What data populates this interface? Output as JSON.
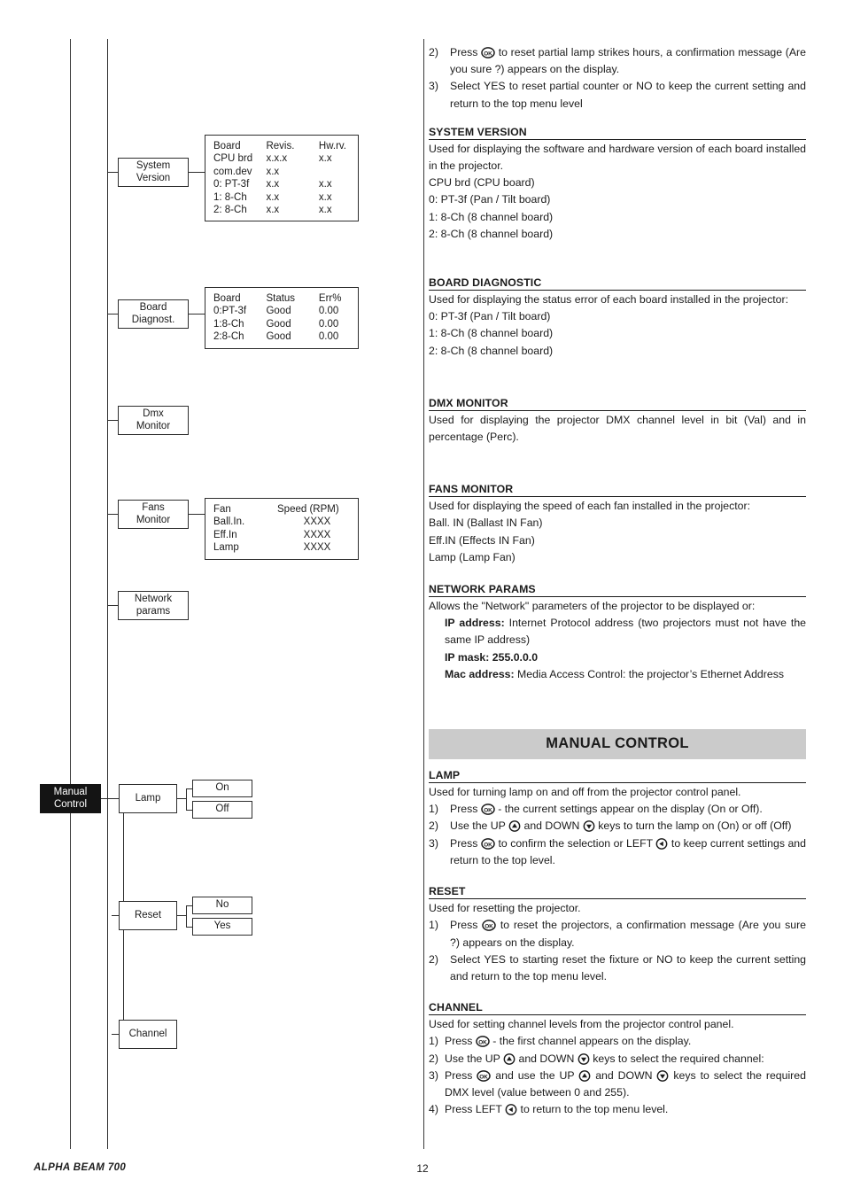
{
  "footer": {
    "model": "ALPHA BEAM 700",
    "page": "12"
  },
  "icons": {
    "ok": "OK",
    "up": "up-arrow",
    "down": "down-arrow",
    "left": "left-arrow"
  },
  "diagram": {
    "nodes": {
      "system_version": {
        "line1": "System",
        "line2": "Version"
      },
      "board_diagnost": {
        "line1": "Board",
        "line2": "Diagnost."
      },
      "dmx_monitor": {
        "line1": "Dmx",
        "line2": "Monitor"
      },
      "fans_monitor": {
        "line1": "Fans",
        "line2": "Monitor"
      },
      "network_params": {
        "line1": "Network",
        "line2": "params"
      },
      "manual_control": {
        "line1": "Manual",
        "line2": "Control"
      },
      "lamp": {
        "line1": "Lamp",
        "line2": ""
      },
      "lamp_on": {
        "line1": "On",
        "line2": ""
      },
      "lamp_off": {
        "line1": "Off",
        "line2": ""
      },
      "reset": {
        "line1": "Reset",
        "line2": ""
      },
      "reset_no": {
        "line1": "No",
        "line2": ""
      },
      "reset_yes": {
        "line1": "Yes",
        "line2": ""
      },
      "channel": {
        "line1": "Channel",
        "line2": ""
      }
    },
    "system_version_table": {
      "headers": [
        "Board",
        "Revis.",
        "Hw.rv."
      ],
      "rows": [
        [
          "CPU brd",
          "x.x.x",
          "x.x"
        ],
        [
          "com.dev",
          "x.x",
          ""
        ],
        [
          "0: PT-3f",
          "x.x",
          "x.x"
        ],
        [
          "1: 8-Ch",
          "x.x",
          "x.x"
        ],
        [
          "2: 8-Ch",
          "x.x",
          "x.x"
        ]
      ]
    },
    "board_diagnostic_table": {
      "headers": [
        "Board",
        "Status",
        "Err%"
      ],
      "rows": [
        [
          "0:PT-3f",
          "Good",
          "0.00"
        ],
        [
          "1:8-Ch",
          "Good",
          "0.00"
        ],
        [
          "2:8-Ch",
          "Good",
          "0.00"
        ]
      ]
    },
    "fans_monitor_table": {
      "headers": [
        "Fan",
        "Speed (RPM)"
      ],
      "rows": [
        [
          "Ball.In.",
          "XXXX"
        ],
        [
          "Eff.In",
          "XXXX"
        ],
        [
          "Lamp",
          "XXXX"
        ]
      ]
    }
  },
  "content": {
    "intro": {
      "item2_a": "2)",
      "item2_b": "Press",
      "item2_c": "to reset partial lamp strikes hours, a confirmation message (Are you sure ?) appears on the display.",
      "item3_a": "3)",
      "item3_b": "Select YES to reset partial counter or NO to keep the current setting and return to the top menu level"
    },
    "system_version": {
      "title": "SYSTEM VERSION",
      "body": "Used for displaying the software and hardware version of each board installed in the projector.",
      "lines": [
        "CPU brd (CPU board)",
        "0: PT-3f (Pan / Tilt board)",
        "1: 8-Ch (8 channel board)",
        "2: 8-Ch (8 channel board)"
      ]
    },
    "board_diagnostic": {
      "title": "BOARD DIAGNOSTIC",
      "body": "Used for displaying the status error of each board installed in the projector:",
      "lines": [
        "0: PT-3f (Pan / Tilt board)",
        "1: 8-Ch (8 channel board)",
        "2: 8-Ch (8 channel board)"
      ]
    },
    "dmx_monitor": {
      "title": "DMX MONITOR",
      "body": "Used for displaying the projector DMX channel level in bit (Val) and in percentage (Perc)."
    },
    "fans_monitor": {
      "title": "FANS MONITOR",
      "body": "Used for displaying the speed of each fan installed in the projector:",
      "lines": [
        "Ball. IN (Ballast IN Fan)",
        "Eff.IN (Effects IN Fan)",
        "Lamp (Lamp Fan)"
      ]
    },
    "network_params": {
      "title": "NETWORK PARAMS",
      "body": "Allows the \"Network\" parameters of the projector to be displayed or:",
      "ip_address_label": "IP address:",
      "ip_address_text": " Internet Protocol address (two projectors must not have the same IP address)",
      "ip_mask_label": "IP mask: 255.0.0.0",
      "mac_label": "Mac address:",
      "mac_text": " Media Access Control: the projector’s Ethernet Address"
    },
    "manual_control_banner": "MANUAL CONTROL",
    "lamp": {
      "title": "LAMP",
      "body": "Used for turning lamp on and off from the projector control panel.",
      "n1": "1)",
      "n1_a": "Press",
      "n1_b": "- the current settings appear on the display (On or Off).",
      "n2": "2)",
      "n2_a": "Use the UP",
      "n2_b": "and DOWN",
      "n2_c": "keys to turn the lamp on (On) or off (Off)",
      "n3": "3)",
      "n3_a": "Press",
      "n3_b": "to confirm the selection or LEFT",
      "n3_c": "to keep current settings and return to the top level."
    },
    "reset": {
      "title": "RESET",
      "body": "Used for resetting the projector.",
      "n1": "1)",
      "n1_a": "Press",
      "n1_b": "to reset the projectors, a confirmation message (Are you sure ?) appears on the display.",
      "n2": "2)",
      "n2_a": "Select YES to starting reset the fixture or NO to keep the current setting and return to the top menu level."
    },
    "channel": {
      "title": "CHANNEL",
      "body": "Used for setting channel levels from the projector control panel.",
      "n1": "1)",
      "n1_a": "Press",
      "n1_b": "- the first channel appears on the display.",
      "n2": "2)",
      "n2_a": "Use the UP",
      "n2_b": "and DOWN",
      "n2_c": "keys to select the required channel:",
      "n3": "3)",
      "n3_a": "Press",
      "n3_b": "and use the UP",
      "n3_c": "and DOWN",
      "n3_d": "keys to select the required DMX level (value between 0 and 255).",
      "n4": "4)",
      "n4_a": "Press LEFT",
      "n4_b": "to return to the top menu level."
    }
  }
}
